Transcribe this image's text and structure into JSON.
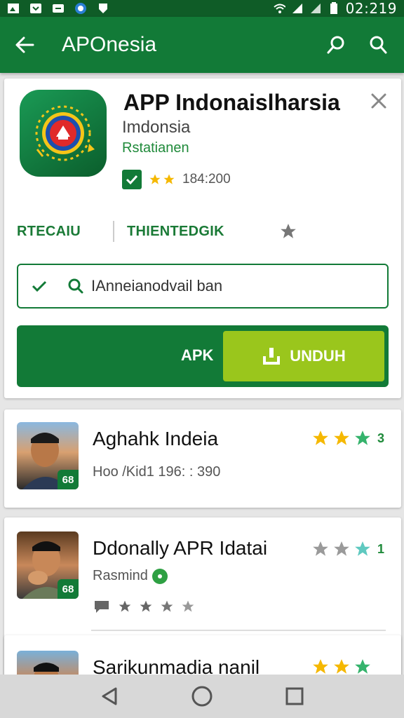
{
  "status_bar": {
    "time": "02:219"
  },
  "app_bar": {
    "title": "APOnesia"
  },
  "detail": {
    "title": "APP Indonaislharsia",
    "subtitle": "Imdonsia",
    "developer": "Rstatianen",
    "rating_count": "184:200",
    "tabs": [
      "RTECAIU",
      "THIENTEDGIK"
    ],
    "search_value": "IAnneianodvail ban",
    "apk_label": "APK",
    "download_label": "UNDUH"
  },
  "list": [
    {
      "title": "Aghahk Indeia",
      "subtitle": "Hoo /Kid1 196: : 390",
      "rating": "3",
      "badge": "68"
    },
    {
      "title": "Ddonally APR Idatai",
      "subtitle": "Rasmind",
      "rating": "1",
      "badge": "68"
    },
    {
      "title": "Sarikunmadia nanil"
    }
  ],
  "colors": {
    "primary": "#127a37",
    "accent": "#9ac61c",
    "star": "#f5b800",
    "star_teal": "#35b36c"
  }
}
